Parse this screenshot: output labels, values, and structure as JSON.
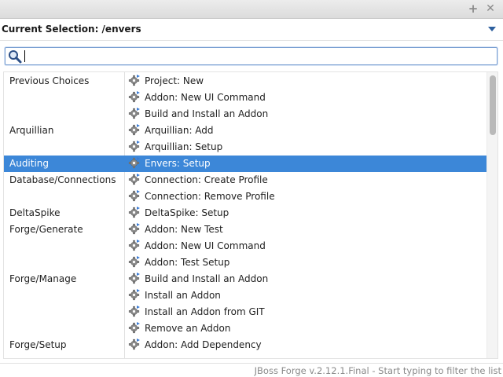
{
  "window": {
    "buttons": [
      {
        "name": "plus-icon",
        "glyph": "+"
      },
      {
        "name": "close-icon",
        "glyph": "✕"
      }
    ]
  },
  "selection": {
    "title": "Current Selection: /envers",
    "dropdown_icon": "triangle-down-icon"
  },
  "search": {
    "value": "",
    "placeholder": "",
    "icon": "magnifier-icon"
  },
  "categories": [
    {
      "label": "Previous Choices",
      "row": 0
    },
    {
      "label": "Arquillian",
      "row": 3
    },
    {
      "label": "Auditing",
      "row": 5,
      "selected": true
    },
    {
      "label": "Database/Connections",
      "row": 6
    },
    {
      "label": "DeltaSpike",
      "row": 8
    },
    {
      "label": "Forge/Generate",
      "row": 9
    },
    {
      "label": "Forge/Manage",
      "row": 12
    },
    {
      "label": "Forge/Setup",
      "row": 16
    }
  ],
  "commands": [
    {
      "label": "Project: New"
    },
    {
      "label": "Addon: New UI Command"
    },
    {
      "label": "Build and Install an Addon"
    },
    {
      "label": "Arquillian: Add"
    },
    {
      "label": "Arquillian: Setup"
    },
    {
      "label": "Envers: Setup",
      "selected": true
    },
    {
      "label": "Connection: Create Profile"
    },
    {
      "label": "Connection: Remove Profile"
    },
    {
      "label": "DeltaSpike: Setup"
    },
    {
      "label": "Addon: New Test"
    },
    {
      "label": "Addon: New UI Command"
    },
    {
      "label": "Addon: Test Setup"
    },
    {
      "label": "Build and Install an Addon"
    },
    {
      "label": "Install an Addon"
    },
    {
      "label": "Install an Addon from GIT"
    },
    {
      "label": "Remove an Addon"
    },
    {
      "label": "Addon: Add Dependency"
    }
  ],
  "command_icon": "gear-icon",
  "colors": {
    "selection": "#3c87d8",
    "selection_text": "#ffffff",
    "search_border": "#7a9fd2",
    "dropdown_arrow": "#2d5f9e"
  },
  "status": {
    "text": "JBoss Forge v.2.12.1.Final - Start typing to filter the list"
  }
}
